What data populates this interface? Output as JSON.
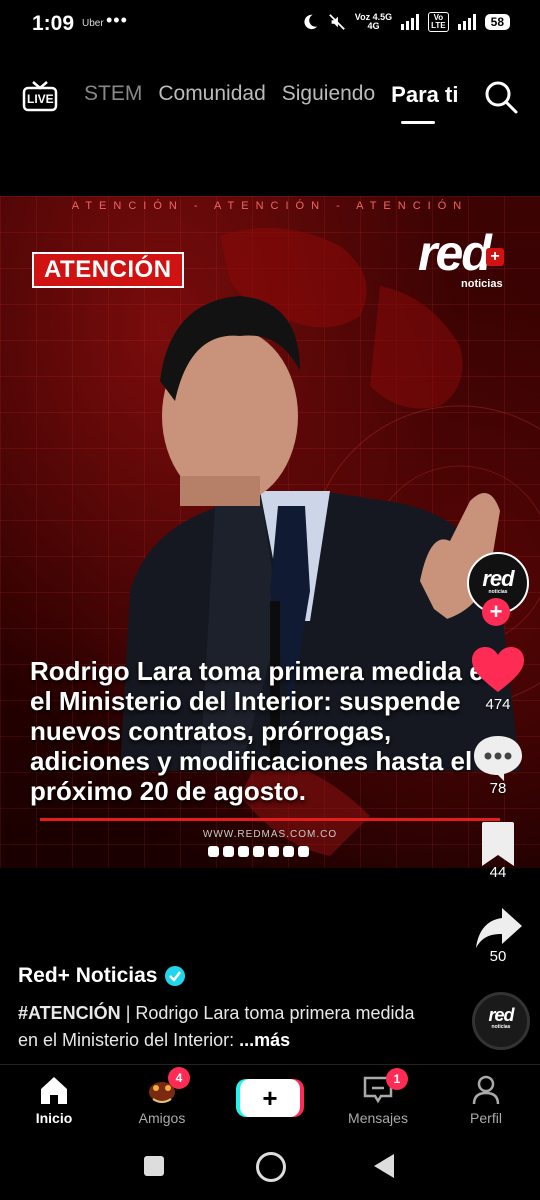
{
  "status": {
    "time": "1:09",
    "carrier_app": "Uber",
    "dots": "•••",
    "network_top": "Voz 4.5G",
    "network_bottom": "4G",
    "volte_top": "Vo",
    "volte_bottom": "LTE",
    "battery": "58"
  },
  "top_nav": {
    "live_label": "LIVE",
    "tabs": [
      "STEM",
      "Comunidad",
      "Siguiendo",
      "Para ti"
    ],
    "active_tab": "Para ti"
  },
  "video": {
    "marquee": "ATENCIÓN - ATENCIÓN - ATENCIÓN",
    "badge": "ATENCIÓN",
    "logo_text": "red",
    "logo_plus": "+",
    "logo_sub": "noticias",
    "caption": "Rodrigo Lara toma primera medida en el Ministerio del Interior: suspende nuevos contratos, prórrogas, adiciones y modificaciones hasta el próximo 20 de agosto.",
    "website": "WWW.REDMAS.COM.CO"
  },
  "rail": {
    "avatar_text": "red",
    "avatar_sub": "noticias",
    "follow": "+",
    "likes": "474",
    "comments": "78",
    "saves": "44",
    "shares": "50"
  },
  "post": {
    "author": "Red+ Noticias",
    "hashtag": "#ATENCIÓN",
    "desc_text": " | Rodrigo Lara toma primera medida en el Ministerio del Interior: ",
    "more": "...más"
  },
  "bottom_nav": {
    "home": "Inicio",
    "friends": "Amigos",
    "friends_badge": "4",
    "create": "+",
    "inbox": "Mensajes",
    "inbox_badge": "1",
    "profile": "Perfil"
  },
  "colors": {
    "accent_red": "#d01212",
    "like_pink": "#fe2c55",
    "verified_blue": "#20d5ec"
  }
}
